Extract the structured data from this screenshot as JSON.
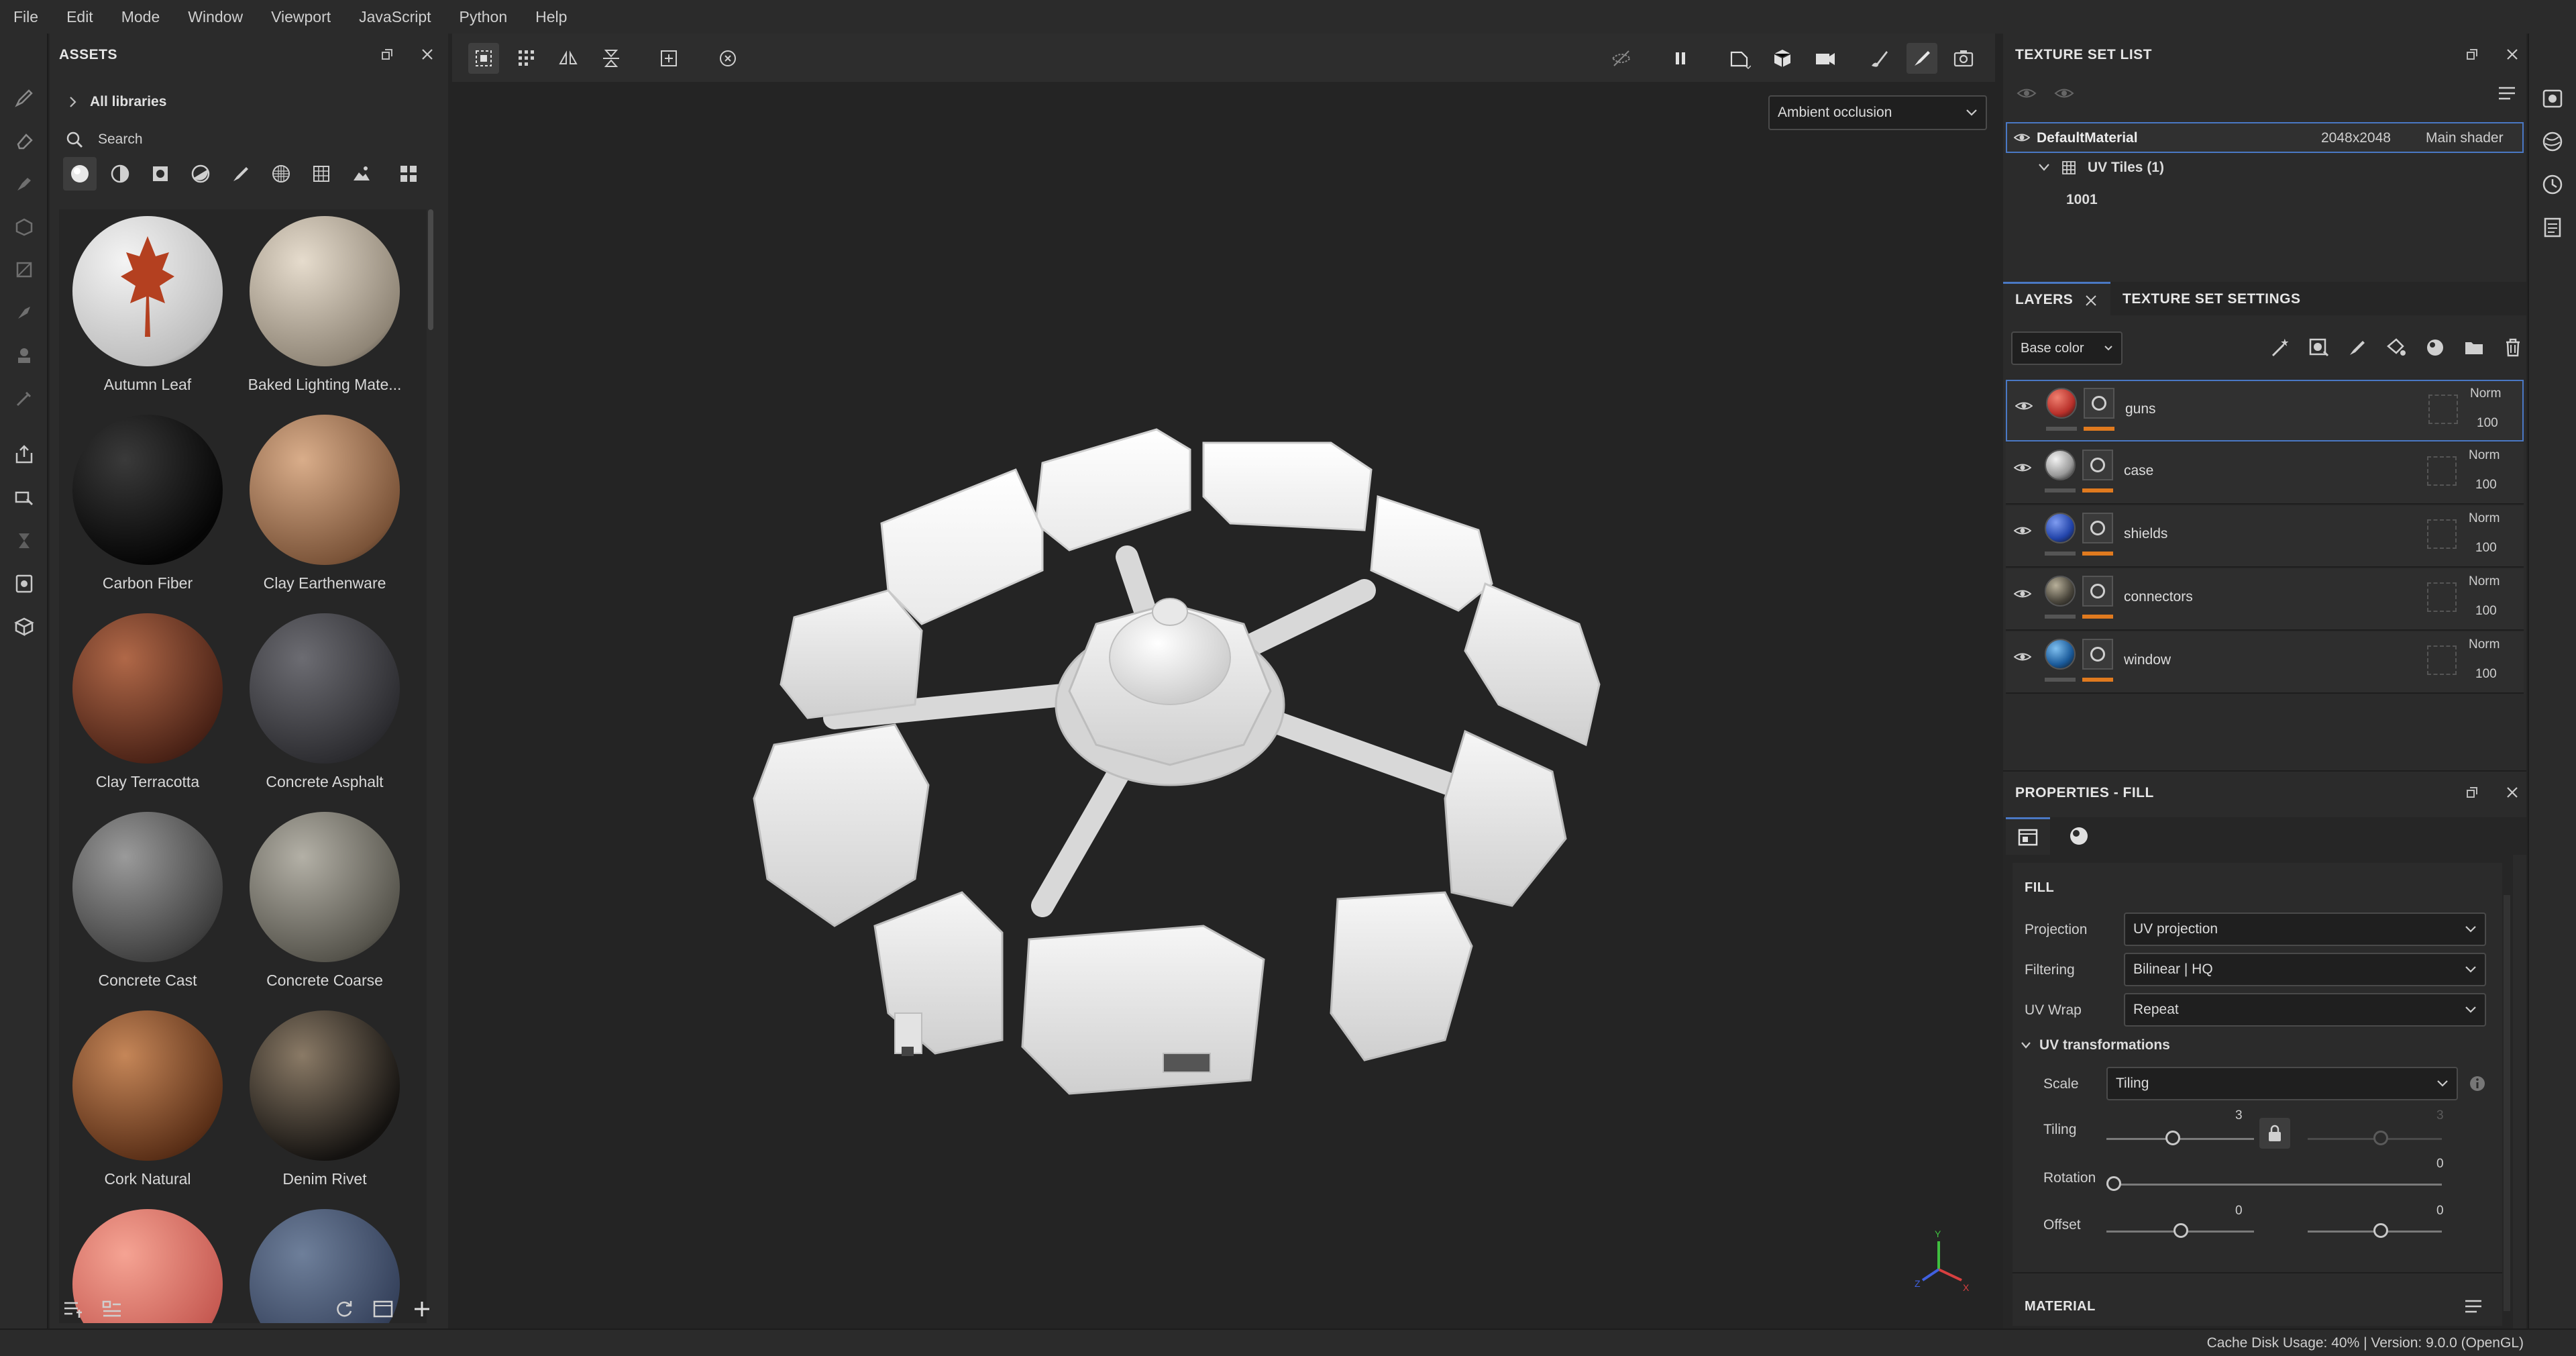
{
  "menu": [
    "File",
    "Edit",
    "Mode",
    "Window",
    "Viewport",
    "JavaScript",
    "Python",
    "Help"
  ],
  "assets": {
    "title": "ASSETS",
    "breadcrumb": "All libraries",
    "search_placeholder": "Search",
    "items": [
      {
        "label": "Autumn Leaf",
        "color_a": "#f4f4f4",
        "color_b": "#bdbdbd"
      },
      {
        "label": "Baked Lighting Mate...",
        "color_a": "#e6dccd",
        "color_b": "#8f8576"
      },
      {
        "label": "Carbon Fiber",
        "color_a": "#3a3a3a",
        "color_b": "#050505"
      },
      {
        "label": "Clay Earthenware",
        "color_a": "#d9ad8a",
        "color_b": "#7a5338"
      },
      {
        "label": "Clay Terracotta",
        "color_a": "#b06848",
        "color_b": "#4a2216"
      },
      {
        "label": "Concrete Asphalt",
        "color_a": "#6c6c72",
        "color_b": "#2c2c30"
      },
      {
        "label": "Concrete Cast",
        "color_a": "#9a9a9a",
        "color_b": "#3f3f3f"
      },
      {
        "label": "Concrete Coarse",
        "color_a": "#b3b0a6",
        "color_b": "#56544c"
      },
      {
        "label": "Cork Natural",
        "color_a": "#c58658",
        "color_b": "#5a2f17"
      },
      {
        "label": "Denim Rivet",
        "color_a": "#8a7a66",
        "color_b": "#141210"
      },
      {
        "label": "",
        "color_a": "#f5a393",
        "color_b": "#c65a52"
      },
      {
        "label": "",
        "color_a": "#6e7f9a",
        "color_b": "#34405a"
      }
    ]
  },
  "viewport": {
    "channel_dropdown": "Ambient occlusion",
    "axis_labels": {
      "x": "X",
      "y": "Y",
      "z": "Z"
    }
  },
  "texture_set_list": {
    "title": "TEXTURE SET LIST",
    "material_name": "DefaultMaterial",
    "resolution": "2048x2048",
    "shader": "Main shader",
    "uv_tiles": "UV Tiles (1)",
    "tile_id": "1001"
  },
  "layers": {
    "tab_layers": "LAYERS",
    "tab_settings": "TEXTURE SET SETTINGS",
    "channel": "Base color",
    "items": [
      {
        "name": "guns",
        "blend": "Norm",
        "opacity": "100",
        "ball": "#b8302a",
        "ball_hi": "#f08070"
      },
      {
        "name": "case",
        "blend": "Norm",
        "opacity": "100",
        "ball": "#9a9a9a",
        "ball_hi": "#f2f2f2"
      },
      {
        "name": "shields",
        "blend": "Norm",
        "opacity": "100",
        "ball": "#2244aa",
        "ball_hi": "#7f9cf0"
      },
      {
        "name": "connectors",
        "blend": "Norm",
        "opacity": "100",
        "ball": "#4a463c",
        "ball_hi": "#b8b09a"
      },
      {
        "name": "window",
        "blend": "Norm",
        "opacity": "100",
        "ball": "#1a5a9a",
        "ball_hi": "#7fc0f0"
      }
    ]
  },
  "properties": {
    "title": "PROPERTIES - FILL",
    "section_fill": "FILL",
    "projection_label": "Projection",
    "projection_value": "UV projection",
    "filtering_label": "Filtering",
    "filtering_value": "Bilinear | HQ",
    "uvwrap_label": "UV Wrap",
    "uvwrap_value": "Repeat",
    "uv_transform_label": "UV transformations",
    "scale_label": "Scale",
    "scale_value": "Tiling",
    "tiling_label": "Tiling",
    "tiling_value": "3",
    "tiling_value_locked": "3",
    "tiling_fraction": 0.45,
    "rotation_label": "Rotation",
    "rotation_value": "0",
    "offset_label": "Offset",
    "offset_x": "0",
    "offset_y": "0",
    "section_material": "MATERIAL"
  },
  "status": {
    "text": "Cache Disk Usage:   40%  |  Version: 9.0.0 (OpenGL)"
  },
  "colors": {
    "accent_orange": "#e07a1f",
    "selection_blue": "#4a78c4"
  }
}
